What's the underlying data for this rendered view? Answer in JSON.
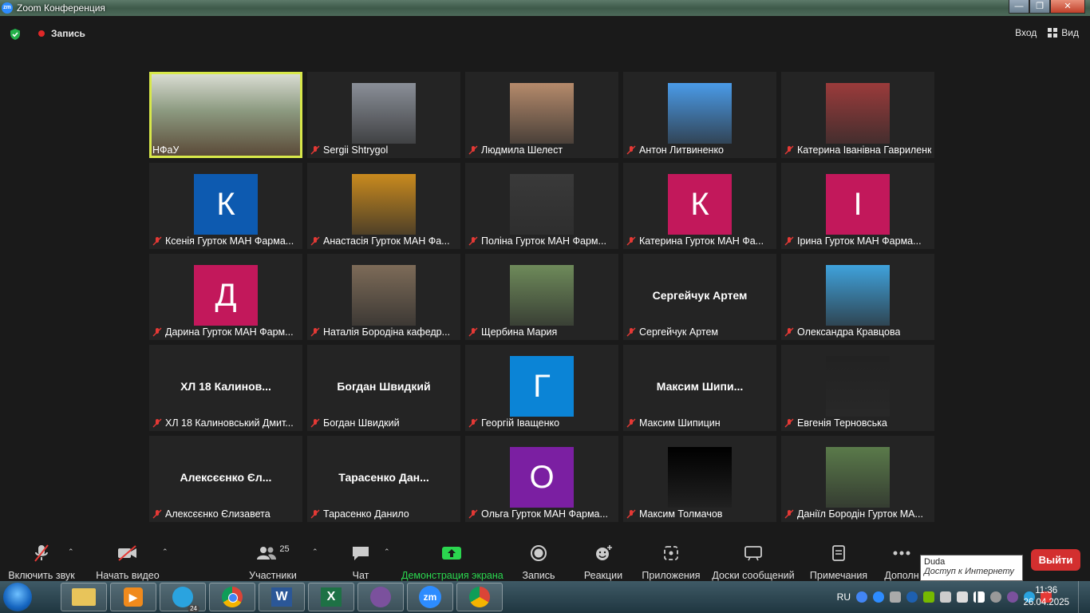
{
  "window": {
    "title": "Zoom Конференция",
    "logo": "zm"
  },
  "header": {
    "recording_label": "Запись",
    "exit_label": "Вход",
    "view_label": "Вид"
  },
  "tiles": [
    {
      "name": "НФаУ",
      "type": "video",
      "active": true
    },
    {
      "name": "Sergii Shtrygol",
      "type": "photo",
      "color": "#8a8f98"
    },
    {
      "name": "Людмила Шелест",
      "type": "photo",
      "color": "#b58a6b"
    },
    {
      "name": "Антон Литвиненко",
      "type": "photo",
      "color": "#4a9be8"
    },
    {
      "name": "Катерина Іванівна Гавриленко",
      "type": "photo",
      "color": "#9b3b3b"
    },
    {
      "name": "Ксенія Гурток МАН Фарма...",
      "type": "letter",
      "letter": "К",
      "color": "#0d5ab0"
    },
    {
      "name": "Анастасія Гурток МАН Фа...",
      "type": "photo",
      "color": "#c98a1e"
    },
    {
      "name": "Поліна Гурток МАН Фарм...",
      "type": "photo",
      "color": "#3a3a3a"
    },
    {
      "name": "Катерина Гурток МАН Фа...",
      "type": "letter",
      "letter": "К",
      "color": "#c2185b"
    },
    {
      "name": "Ірина Гурток МАН Фарма...",
      "type": "letter",
      "letter": "І",
      "color": "#c2185b"
    },
    {
      "name": "Дарина Гурток МАН Фарм...",
      "type": "letter",
      "letter": "Д",
      "color": "#c2185b"
    },
    {
      "name": "Наталія Бородіна кафедр...",
      "type": "photo",
      "color": "#7d6b58"
    },
    {
      "name": "Щербина Мария",
      "type": "photo",
      "color": "#6e8a5a"
    },
    {
      "name": "Сергейчук Артем",
      "type": "text",
      "display": "Сергейчук Артем"
    },
    {
      "name": "Олександра Кравцова",
      "type": "photo",
      "color": "#3fa2dc"
    },
    {
      "name": "ХЛ 18 Калиновський Дмит...",
      "type": "text",
      "display": "ХЛ 18 Калинов..."
    },
    {
      "name": "Богдан Швидкий",
      "type": "text",
      "display": "Богдан Швидкий"
    },
    {
      "name": "Георгій Іващенко",
      "type": "letter",
      "letter": "Г",
      "color": "#0b84d6"
    },
    {
      "name": "Максим Шипицин",
      "type": "text",
      "display": "Максим  Шипи..."
    },
    {
      "name": "Евгенія Терновська",
      "type": "photo",
      "color": "#222222"
    },
    {
      "name": "Алексєєнко Єлизавета",
      "type": "text",
      "display": "Алексєєнко Єл..."
    },
    {
      "name": "Тарасенко Данило",
      "type": "text",
      "display": "Тарасенко  Дан..."
    },
    {
      "name": "Ольга Гурток МАН Фарма...",
      "type": "letter",
      "letter": "О",
      "color": "#7b1fa2"
    },
    {
      "name": "Максим Толмачов",
      "type": "photo",
      "color": "#000000"
    },
    {
      "name": "Даніїл Бородін Гурток МА...",
      "type": "photo",
      "color": "#5a7a4a"
    }
  ],
  "toolbar": {
    "audio_label": "Включить звук",
    "video_label": "Начать видео",
    "participants_label": "Участники",
    "participants_count": "25",
    "chat_label": "Чат",
    "share_label": "Демонстрация экрана",
    "record_label": "Запись",
    "reactions_label": "Реакции",
    "apps_label": "Приложения",
    "whiteboards_label": "Доски сообщений",
    "notes_label": "Примечания",
    "more_label": "Дополн",
    "leave_label": "Выйти"
  },
  "tooltip": {
    "title": "Duda",
    "subtitle": "Доступ к Интернету"
  },
  "taskbar": {
    "apps": [
      "explorer",
      "media-player",
      "telegram",
      "chrome",
      "word",
      "excel",
      "viber",
      "zoom",
      "chrome-profile"
    ],
    "telegram_badge": "24",
    "lang": "RU",
    "time": "11:36",
    "date": "26.04.2025"
  }
}
